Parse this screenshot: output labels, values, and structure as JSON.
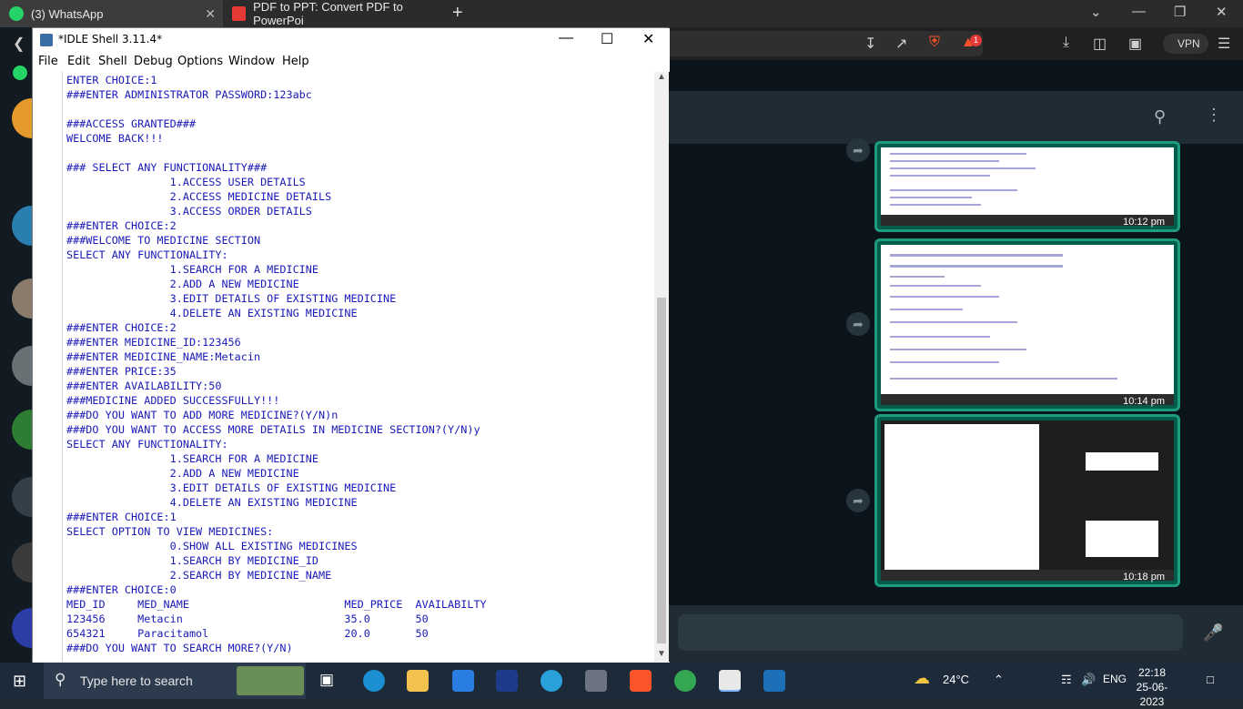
{
  "browser": {
    "tabs": [
      {
        "title": "(3) WhatsApp"
      },
      {
        "title": "PDF to PPT: Convert PDF to PowerPoi"
      }
    ],
    "vpn_label": "VPN",
    "brave_badge": "1"
  },
  "whatsapp": {
    "thumbnails": [
      {
        "time": "10:12 pm"
      },
      {
        "time": "10:14 pm"
      },
      {
        "time": "10:18 pm"
      }
    ]
  },
  "idle": {
    "title": "*IDLE Shell 3.11.4*",
    "menu": [
      "File",
      "Edit",
      "Shell",
      "Debug",
      "Options",
      "Window",
      "Help"
    ],
    "lines": [
      "ENTER CHOICE:1",
      "###ENTER ADMINISTRATOR PASSWORD:123abc",
      "",
      "###ACCESS GRANTED###",
      "WELCOME BACK!!!",
      "",
      "### SELECT ANY FUNCTIONALITY###",
      "                1.ACCESS USER DETAILS",
      "                2.ACCESS MEDICINE DETAILS",
      "                3.ACCESS ORDER DETAILS",
      "###ENTER CHOICE:2",
      "###WELCOME TO MEDICINE SECTION",
      "SELECT ANY FUNCTIONALITY:",
      "                1.SEARCH FOR A MEDICINE",
      "                2.ADD A NEW MEDICINE",
      "                3.EDIT DETAILS OF EXISTING MEDICINE",
      "                4.DELETE AN EXISTING MEDICINE",
      "###ENTER CHOICE:2",
      "###ENTER MEDICINE_ID:123456",
      "###ENTER MEDICINE_NAME:Metacin",
      "###ENTER PRICE:35",
      "###ENTER AVAILABILITY:50",
      "###MEDICINE ADDED SUCCESSFULLY!!!",
      "###DO YOU WANT TO ADD MORE MEDICINE?(Y/N)n",
      "###DO YOU WANT TO ACCESS MORE DETAILS IN MEDICINE SECTION?(Y/N)y",
      "SELECT ANY FUNCTIONALITY:",
      "                1.SEARCH FOR A MEDICINE",
      "                2.ADD A NEW MEDICINE",
      "                3.EDIT DETAILS OF EXISTING MEDICINE",
      "                4.DELETE AN EXISTING MEDICINE",
      "###ENTER CHOICE:1",
      "SELECT OPTION TO VIEW MEDICINES:",
      "                0.SHOW ALL EXISTING MEDICINES",
      "                1.SEARCH BY MEDICINE_ID",
      "                2.SEARCH BY MEDICINE_NAME",
      "###ENTER CHOICE:0",
      "MED_ID     MED_NAME                        MED_PRICE  AVAILABILTY",
      "123456     Metacin                         35.0       50",
      "654321     Paracitamol                     20.0       50",
      "###DO YOU WANT TO SEARCH MORE?(Y/N)"
    ]
  },
  "taskbar": {
    "search_placeholder": "Type here to search",
    "weather": "24°C",
    "language": "ENG",
    "time": "22:18",
    "date": "25-06-2023"
  }
}
